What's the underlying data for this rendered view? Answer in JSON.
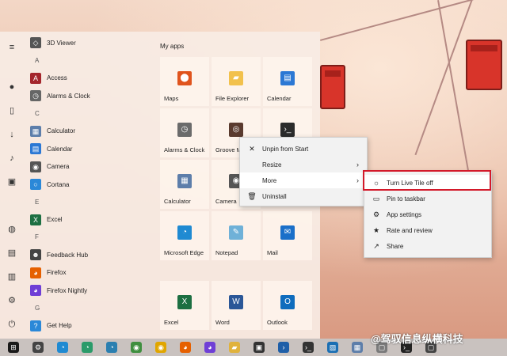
{
  "colors": {
    "accent_highlight": "#d3192a",
    "menu_bg": "#f2f2f2",
    "taskbar_bg": "#c9c2bf"
  },
  "rail_icons": [
    "hamburger-icon",
    "user-avatar-icon",
    "document-icon",
    "download-icon",
    "music-icon",
    "pictures-icon",
    "network-icon",
    "video-icon",
    "library-icon",
    "settings-icon",
    "power-icon"
  ],
  "app_list": {
    "items": [
      {
        "type": "app",
        "label": "3D Viewer",
        "icon": "cube-icon"
      },
      {
        "type": "letter",
        "label": "A"
      },
      {
        "type": "app",
        "label": "Access",
        "icon": "access-icon"
      },
      {
        "type": "app",
        "label": "Alarms & Clock",
        "icon": "clock-icon"
      },
      {
        "type": "letter",
        "label": "C"
      },
      {
        "type": "app",
        "label": "Calculator",
        "icon": "calculator-icon"
      },
      {
        "type": "app",
        "label": "Calendar",
        "icon": "calendar-icon"
      },
      {
        "type": "app",
        "label": "Camera",
        "icon": "camera-icon"
      },
      {
        "type": "app",
        "label": "Cortana",
        "icon": "cortana-icon"
      },
      {
        "type": "letter",
        "label": "E"
      },
      {
        "type": "app",
        "label": "Excel",
        "icon": "excel-icon"
      },
      {
        "type": "letter",
        "label": "F"
      },
      {
        "type": "app",
        "label": "Feedback Hub",
        "icon": "feedback-icon"
      },
      {
        "type": "app",
        "label": "Firefox",
        "icon": "firefox-icon"
      },
      {
        "type": "app",
        "label": "Firefox Nightly",
        "icon": "firefox-nightly-icon"
      },
      {
        "type": "letter",
        "label": "G"
      },
      {
        "type": "app",
        "label": "Get Help",
        "icon": "help-icon"
      }
    ]
  },
  "tiles": {
    "title": "My apps",
    "items": [
      {
        "label": "Maps",
        "icon": "maps-icon",
        "color": "#e0541d"
      },
      {
        "label": "File Explorer",
        "icon": "folder-icon",
        "color": "#f2c14c"
      },
      {
        "label": "Calendar",
        "icon": "calendar-icon",
        "color": "#2c78d4"
      },
      {
        "label": "Alarms & Clock",
        "icon": "clock-icon",
        "color": "#6b6b6b"
      },
      {
        "label": "Groove M",
        "icon": "groove-icon",
        "color": "#5a3a2e"
      },
      {
        "label": "",
        "icon": "terminal-icon",
        "color": "#2b2b2b"
      },
      {
        "label": "Calculator",
        "icon": "calculator-icon",
        "color": "#5d7eaa"
      },
      {
        "label": "Camera",
        "icon": "camera-icon",
        "color": "#555555"
      },
      {
        "label": "",
        "icon": "",
        "color": ""
      },
      {
        "label": "Microsoft Edge",
        "icon": "edge-icon",
        "color": "#1f8ad2"
      },
      {
        "label": "Notepad",
        "icon": "notepad-icon",
        "color": "#6fb1d8"
      },
      {
        "label": "Mail",
        "icon": "mail-icon",
        "color": "#1a6fc9"
      },
      {
        "label": "Excel",
        "icon": "excel-icon",
        "color": "#1d6f42"
      },
      {
        "label": "Word",
        "icon": "word-icon",
        "color": "#2b5797"
      },
      {
        "label": "Outlook",
        "icon": "outlook-icon",
        "color": "#0f6cbd"
      }
    ]
  },
  "context_menu": {
    "items": [
      {
        "label": "Unpin from Start",
        "icon": "unpin-icon",
        "arrow": false
      },
      {
        "label": "Resize",
        "icon": "",
        "arrow": true
      },
      {
        "label": "More",
        "icon": "",
        "arrow": true
      },
      {
        "label": "Uninstall",
        "icon": "trash-icon",
        "arrow": false
      }
    ]
  },
  "submenu": {
    "items": [
      {
        "label": "Turn Live Tile off",
        "icon": "sun-icon"
      },
      {
        "label": "Pin to taskbar",
        "icon": "pin-icon"
      },
      {
        "label": "App settings",
        "icon": "gear-icon"
      },
      {
        "label": "Rate and review",
        "icon": "star-icon"
      },
      {
        "label": "Share",
        "icon": "share-icon"
      }
    ]
  },
  "taskbar": {
    "icons": [
      "windows-start-icon",
      "settings-icon",
      "edge-icon",
      "edge-dev-icon",
      "edge-beta-icon",
      "chrome-icon",
      "chrome-canary-icon",
      "firefox-icon",
      "firefox-nightly-icon",
      "file-explorer-icon",
      "store-icon",
      "powershell-icon",
      "terminal-icon",
      "photos-icon",
      "calculator-icon",
      "app-icon",
      "cmd-icon",
      "app-icon"
    ]
  },
  "watermark": "@驾驭信息纵横科技"
}
